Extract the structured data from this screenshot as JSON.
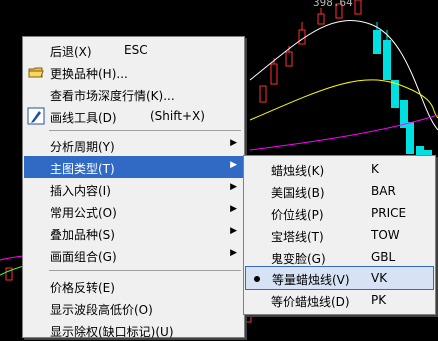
{
  "chart": {
    "price_label": "398.64",
    "colors": {
      "background": "#000000",
      "up_candle": "#ff3030",
      "down_candle": "#00e0e0",
      "ma_white": "#ffffff",
      "ma_yellow": "#ffff00",
      "ma_purple": "#ff00ff"
    }
  },
  "main_menu": {
    "items": [
      {
        "label": "后退(X)",
        "shortcut": "ESC"
      },
      {
        "label": "更换品种(H)...",
        "shortcut": "",
        "icon": "folder-icon"
      },
      {
        "label": "查看市场深度行情(K)...",
        "shortcut": ""
      },
      {
        "label": "画线工具(D)",
        "shortcut": "(Shift+X)",
        "icon": "pencil-icon"
      },
      {
        "label": "分析周期(Y)",
        "submenu": true
      },
      {
        "label": "主图类型(T)",
        "submenu": true,
        "highlighted": true
      },
      {
        "label": "插入内容(I)",
        "submenu": true
      },
      {
        "label": "常用公式(O)",
        "submenu": true
      },
      {
        "label": "叠加品种(S)",
        "submenu": true
      },
      {
        "label": "画面组合(G)",
        "submenu": true
      },
      {
        "label": "价格反转(E)"
      },
      {
        "label": "显示波段高低价(O)"
      },
      {
        "label": "显示除权(缺口标记)(U)"
      }
    ]
  },
  "submenu": {
    "items": [
      {
        "label": "蜡烛线(K)",
        "shortcut": "K"
      },
      {
        "label": "美国线(B)",
        "shortcut": "BAR"
      },
      {
        "label": "价位线(P)",
        "shortcut": "PRICE"
      },
      {
        "label": "宝塔线(T)",
        "shortcut": "TOW"
      },
      {
        "label": "鬼变脸(G)",
        "shortcut": "GBL"
      },
      {
        "label": "等量蜡烛线(V)",
        "shortcut": "VK",
        "checked": true
      },
      {
        "label": "等价蜡烛线(D)",
        "shortcut": "PK"
      }
    ]
  }
}
